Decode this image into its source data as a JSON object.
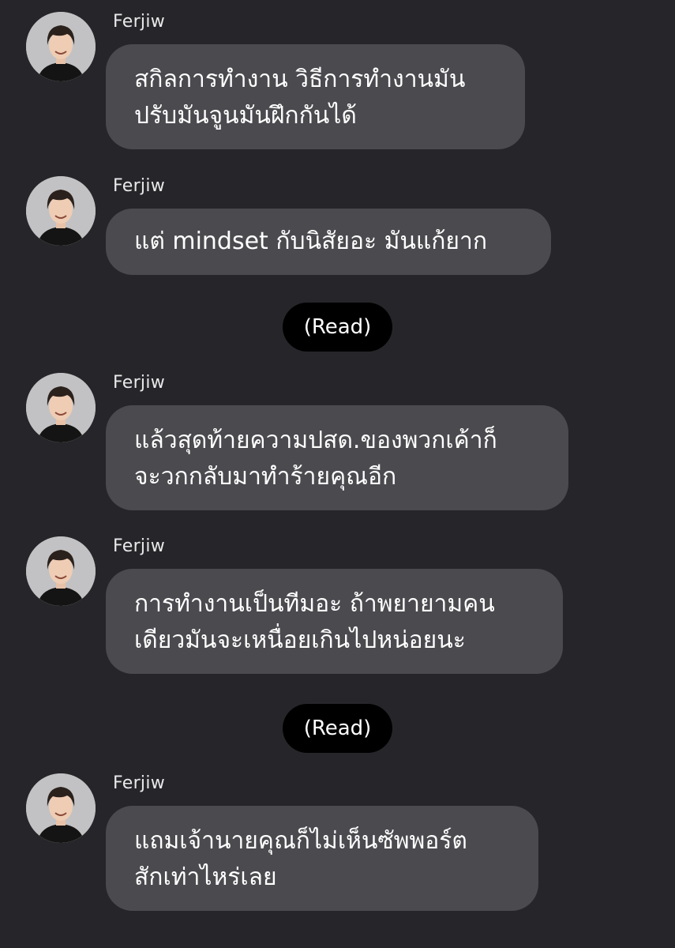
{
  "chat": {
    "messages": [
      {
        "sender": "Ferjiw",
        "avatar_icon": "user-avatar-photo",
        "lines": [
          "สกิลการทำงาน วิธีการทำงานมัน",
          "ปรับมันจูนมันฝึกกันได้"
        ]
      },
      {
        "sender": "Ferjiw",
        "avatar_icon": "user-avatar-photo",
        "lines": [
          "แต่ mindset กับนิสัยอะ มันแก้ยาก"
        ]
      },
      {
        "sender": "Ferjiw",
        "avatar_icon": "user-avatar-photo",
        "lines": [
          "แล้วสุดท้ายความปสด.ของพวกเค้าก็",
          "จะวกกลับมาทำร้ายคุณอีก"
        ]
      },
      {
        "sender": "Ferjiw",
        "avatar_icon": "user-avatar-photo",
        "lines": [
          "การทำงานเป็นทีมอะ ถ้าพยายามคน",
          "เดียวมันจะเหนื่อยเกินไปหน่อยนะ"
        ]
      },
      {
        "sender": "Ferjiw",
        "avatar_icon": "user-avatar-photo",
        "lines": [
          "แถมเจ้านายคุณก็ไม่เห็นซัพพอร์ต",
          "สักเท่าไหร่เลย"
        ]
      }
    ],
    "read_receipts": [
      "(Read)",
      "(Read)"
    ]
  },
  "colors": {
    "background": "#26262a",
    "bubble": "#4a4a4f",
    "read_pill": "#000000",
    "text": "#ffffff"
  }
}
